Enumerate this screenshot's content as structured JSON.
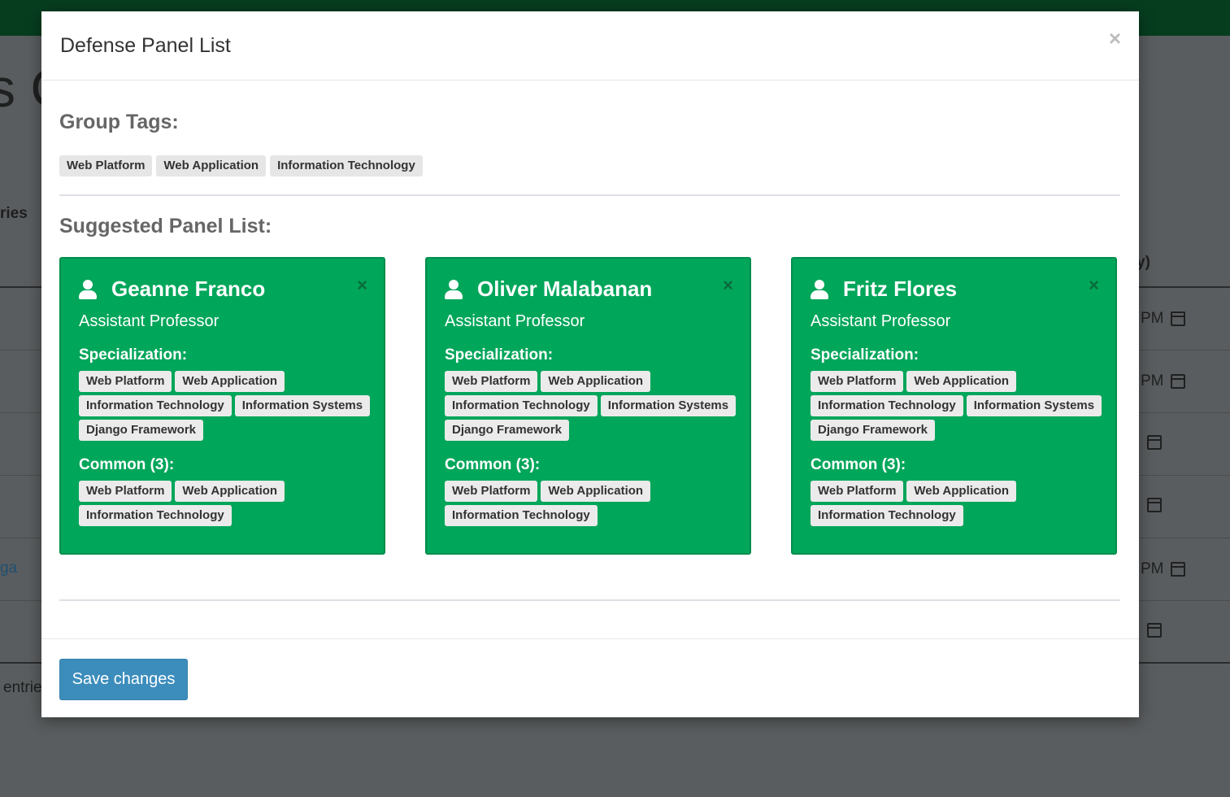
{
  "background": {
    "title_fragment": "s C",
    "left_label": "ries",
    "left_link": "ga",
    "left_footer": "entrie",
    "right_header": "y)",
    "right_cells": [
      "PM",
      "PM",
      "",
      "",
      "PM",
      ""
    ]
  },
  "modal": {
    "title": "Defense Panel List",
    "close_label": "×",
    "group_tags_heading": "Group Tags:",
    "group_tags": [
      "Web Platform",
      "Web Application",
      "Information Technology"
    ],
    "suggested_heading": "Suggested Panel List:",
    "panelists": [
      {
        "name": "Geanne Franco",
        "role": "Assistant Professor",
        "specialization_label": "Specialization:",
        "specializations": [
          "Web Platform",
          "Web Application",
          "Information Technology",
          "Information Systems",
          "Django Framework"
        ],
        "common_label": "Common (3):",
        "common": [
          "Web Platform",
          "Web Application",
          "Information Technology"
        ],
        "close_label": "×"
      },
      {
        "name": "Oliver Malabanan",
        "role": "Assistant Professor",
        "specialization_label": "Specialization:",
        "specializations": [
          "Web Platform",
          "Web Application",
          "Information Technology",
          "Information Systems",
          "Django Framework"
        ],
        "common_label": "Common (3):",
        "common": [
          "Web Platform",
          "Web Application",
          "Information Technology"
        ],
        "close_label": "×"
      },
      {
        "name": "Fritz Flores",
        "role": "Assistant Professor",
        "specialization_label": "Specialization:",
        "specializations": [
          "Web Platform",
          "Web Application",
          "Information Technology",
          "Information Systems",
          "Django Framework"
        ],
        "common_label": "Common (3):",
        "common": [
          "Web Platform",
          "Web Application",
          "Information Technology"
        ],
        "close_label": "×"
      }
    ],
    "save_label": "Save changes"
  },
  "colors": {
    "card_bg": "#00a65a",
    "save_button": "#3c8dbc",
    "topbar": "#063d1f"
  },
  "icons": {
    "panelist": "user-icon",
    "close": "close-icon",
    "calendar": "calendar-icon"
  }
}
